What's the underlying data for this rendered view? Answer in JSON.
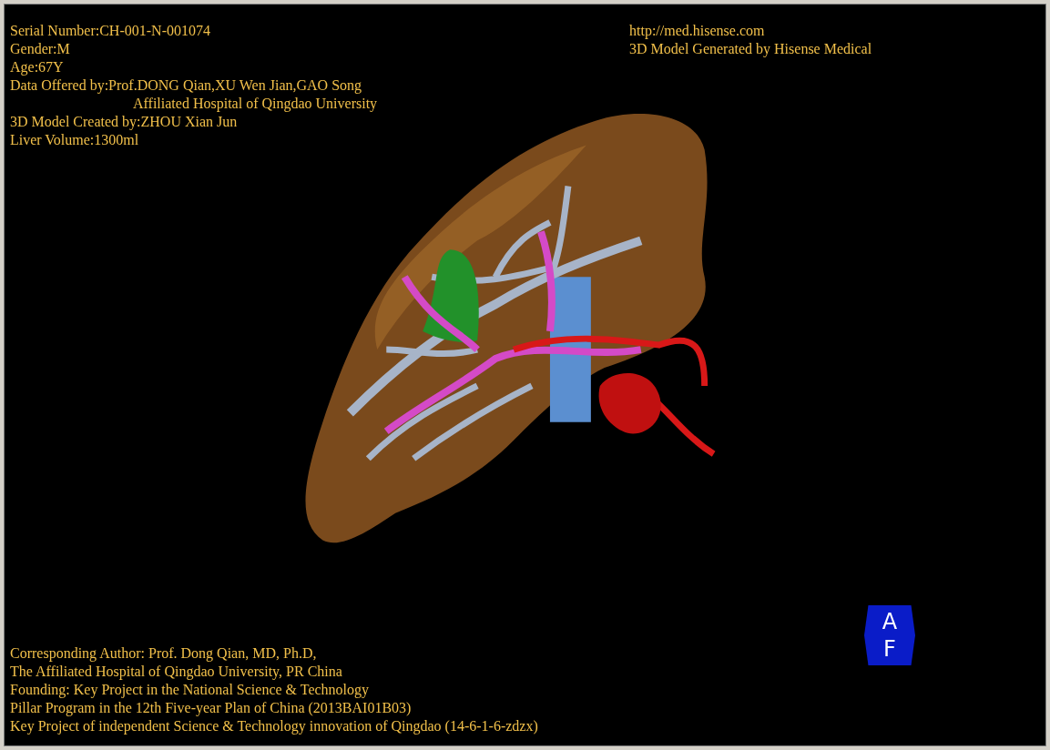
{
  "info_top_left": [
    {
      "kind": "line",
      "text": "Serial Number:CH-001-N-001074"
    },
    {
      "kind": "line",
      "text": "Gender:M"
    },
    {
      "kind": "line",
      "text": "Age:67Y"
    },
    {
      "kind": "line",
      "text": "Data Offered by:Prof.DONG Qian,XU Wen Jian,GAO Song"
    },
    {
      "kind": "continuation",
      "text": "Affiliated Hospital of Qingdao University"
    },
    {
      "kind": "line",
      "text": "3D Model Created by:ZHOU Xian Jun"
    },
    {
      "kind": "line",
      "text": "Liver Volume:1300ml"
    }
  ],
  "info_top_right": [
    "http://med.hisense.com",
    "3D Model Generated by Hisense Medical"
  ],
  "info_bottom": [
    "Corresponding Author: Prof. Dong Qian, MD, Ph.D,",
    "The Affiliated Hospital of Qingdao University, PR China",
    "Founding: Key Project in the National Science & Technology",
    "Pillar Program in the 12th Five-year Plan of China (2013BAI01B03)",
    "Key Project of independent Science & Technology innovation of Qingdao (14-6-1-6-zdzx)"
  ],
  "orientation_marker": {
    "top": "A",
    "bottom": "F"
  }
}
